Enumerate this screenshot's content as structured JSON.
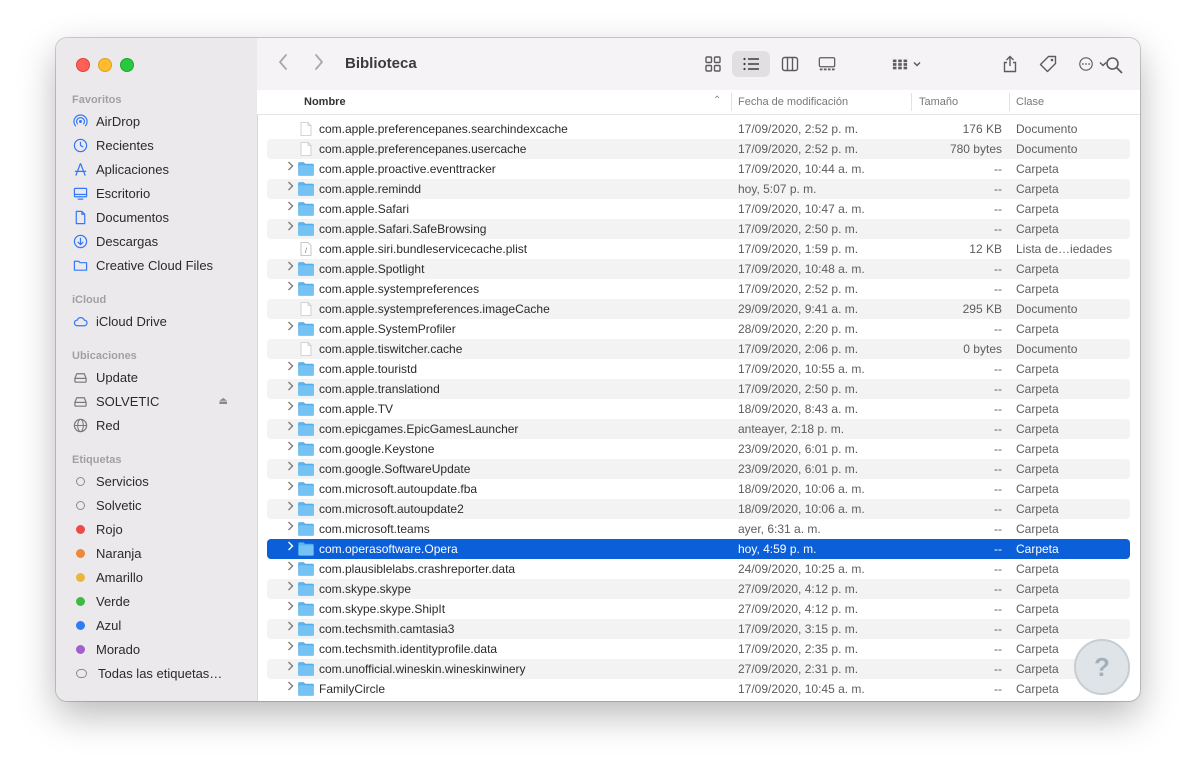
{
  "window": {
    "title": "Biblioteca"
  },
  "sidebar": {
    "favorites_title": "Favoritos",
    "favorites": [
      {
        "label": "AirDrop",
        "icon": "airdrop-icon"
      },
      {
        "label": "Recientes",
        "icon": "clock-icon"
      },
      {
        "label": "Aplicaciones",
        "icon": "applications-icon"
      },
      {
        "label": "Escritorio",
        "icon": "desktop-icon"
      },
      {
        "label": "Documentos",
        "icon": "document-icon"
      },
      {
        "label": "Descargas",
        "icon": "download-icon"
      },
      {
        "label": "Creative Cloud Files",
        "icon": "folder-icon"
      }
    ],
    "icloud_title": "iCloud",
    "icloud": [
      {
        "label": "iCloud Drive",
        "icon": "cloud-icon"
      }
    ],
    "locations_title": "Ubicaciones",
    "locations": [
      {
        "label": "Update",
        "icon": "drive-icon"
      },
      {
        "label": "SOLVETIC",
        "icon": "drive-icon",
        "eject": "⏏"
      },
      {
        "label": "Red",
        "icon": "globe-icon"
      }
    ],
    "tags_title": "Etiquetas",
    "tags": [
      {
        "label": "Servicios",
        "color": "",
        "hollow": true
      },
      {
        "label": "Solvetic",
        "color": "",
        "hollow": true
      },
      {
        "label": "Rojo",
        "color": "#ee4a4a"
      },
      {
        "label": "Naranja",
        "color": "#f0883a"
      },
      {
        "label": "Amarillo",
        "color": "#e9b63f"
      },
      {
        "label": "Verde",
        "color": "#3dbb45"
      },
      {
        "label": "Azul",
        "color": "#2f7cf6"
      },
      {
        "label": "Morado",
        "color": "#a25fd1"
      },
      {
        "label": "Todas las etiquetas…",
        "color": "",
        "allTags": true
      }
    ]
  },
  "columns": {
    "name": "Nombre",
    "date": "Fecha de modificación",
    "size": "Tamaño",
    "kind": "Clase"
  },
  "files": [
    {
      "name": "com.apple.preferencepanes.searchindexcache",
      "date": "17/09/2020, 2:52 p. m.",
      "size": "176 KB",
      "kind": "Documento",
      "type": "file"
    },
    {
      "name": "com.apple.preferencepanes.usercache",
      "date": "17/09/2020, 2:52 p. m.",
      "size": "780 bytes",
      "kind": "Documento",
      "type": "file"
    },
    {
      "name": "com.apple.proactive.eventtracker",
      "date": "17/09/2020, 10:44 a. m.",
      "size": "--",
      "kind": "Carpeta",
      "type": "folder"
    },
    {
      "name": "com.apple.remindd",
      "date": "hoy, 5:07 p. m.",
      "size": "--",
      "kind": "Carpeta",
      "type": "folder"
    },
    {
      "name": "com.apple.Safari",
      "date": "17/09/2020, 10:47 a. m.",
      "size": "--",
      "kind": "Carpeta",
      "type": "folder"
    },
    {
      "name": "com.apple.Safari.SafeBrowsing",
      "date": "17/09/2020, 2:50 p. m.",
      "size": "--",
      "kind": "Carpeta",
      "type": "folder"
    },
    {
      "name": "com.apple.siri.bundleservicecache.plist",
      "date": "17/09/2020, 1:59 p. m.",
      "size": "12 KB",
      "kind": "Lista de…iedades",
      "type": "plist"
    },
    {
      "name": "com.apple.Spotlight",
      "date": "17/09/2020, 10:48 a. m.",
      "size": "--",
      "kind": "Carpeta",
      "type": "folder"
    },
    {
      "name": "com.apple.systempreferences",
      "date": "17/09/2020, 2:52 p. m.",
      "size": "--",
      "kind": "Carpeta",
      "type": "folder"
    },
    {
      "name": "com.apple.systempreferences.imageCache",
      "date": "29/09/2020, 9:41 a. m.",
      "size": "295 KB",
      "kind": "Documento",
      "type": "file"
    },
    {
      "name": "com.apple.SystemProfiler",
      "date": "28/09/2020, 2:20 p. m.",
      "size": "--",
      "kind": "Carpeta",
      "type": "folder"
    },
    {
      "name": "com.apple.tiswitcher.cache",
      "date": "17/09/2020, 2:06 p. m.",
      "size": "0 bytes",
      "kind": "Documento",
      "type": "file"
    },
    {
      "name": "com.apple.touristd",
      "date": "17/09/2020, 10:55 a. m.",
      "size": "--",
      "kind": "Carpeta",
      "type": "folder"
    },
    {
      "name": "com.apple.translationd",
      "date": "17/09/2020, 2:50 p. m.",
      "size": "--",
      "kind": "Carpeta",
      "type": "folder"
    },
    {
      "name": "com.apple.TV",
      "date": "18/09/2020, 8:43 a. m.",
      "size": "--",
      "kind": "Carpeta",
      "type": "folder"
    },
    {
      "name": "com.epicgames.EpicGamesLauncher",
      "date": "anteayer, 2:18 p. m.",
      "size": "--",
      "kind": "Carpeta",
      "type": "folder"
    },
    {
      "name": "com.google.Keystone",
      "date": "23/09/2020, 6:01 p. m.",
      "size": "--",
      "kind": "Carpeta",
      "type": "folder"
    },
    {
      "name": "com.google.SoftwareUpdate",
      "date": "23/09/2020, 6:01 p. m.",
      "size": "--",
      "kind": "Carpeta",
      "type": "folder"
    },
    {
      "name": "com.microsoft.autoupdate.fba",
      "date": "18/09/2020, 10:06 a. m.",
      "size": "--",
      "kind": "Carpeta",
      "type": "folder"
    },
    {
      "name": "com.microsoft.autoupdate2",
      "date": "18/09/2020, 10:06 a. m.",
      "size": "--",
      "kind": "Carpeta",
      "type": "folder"
    },
    {
      "name": "com.microsoft.teams",
      "date": "ayer, 6:31 a. m.",
      "size": "--",
      "kind": "Carpeta",
      "type": "folder"
    },
    {
      "name": "com.operasoftware.Opera",
      "date": "hoy, 4:59 p. m.",
      "size": "--",
      "kind": "Carpeta",
      "type": "folder",
      "selected": true
    },
    {
      "name": "com.plausiblelabs.crashreporter.data",
      "date": "24/09/2020, 10:25 a. m.",
      "size": "--",
      "kind": "Carpeta",
      "type": "folder"
    },
    {
      "name": "com.skype.skype",
      "date": "27/09/2020, 4:12 p. m.",
      "size": "--",
      "kind": "Carpeta",
      "type": "folder"
    },
    {
      "name": "com.skype.skype.ShipIt",
      "date": "27/09/2020, 4:12 p. m.",
      "size": "--",
      "kind": "Carpeta",
      "type": "folder"
    },
    {
      "name": "com.techsmith.camtasia3",
      "date": "17/09/2020, 3:15 p. m.",
      "size": "--",
      "kind": "Carpeta",
      "type": "folder"
    },
    {
      "name": "com.techsmith.identityprofile.data",
      "date": "17/09/2020, 2:35 p. m.",
      "size": "--",
      "kind": "Carpeta",
      "type": "folder"
    },
    {
      "name": "com.unofficial.wineskin.wineskinwinery",
      "date": "27/09/2020, 2:31 p. m.",
      "size": "--",
      "kind": "Carpeta",
      "type": "folder"
    },
    {
      "name": "FamilyCircle",
      "date": "17/09/2020, 10:45 a. m.",
      "size": "--",
      "kind": "Carpeta",
      "type": "folder"
    }
  ]
}
